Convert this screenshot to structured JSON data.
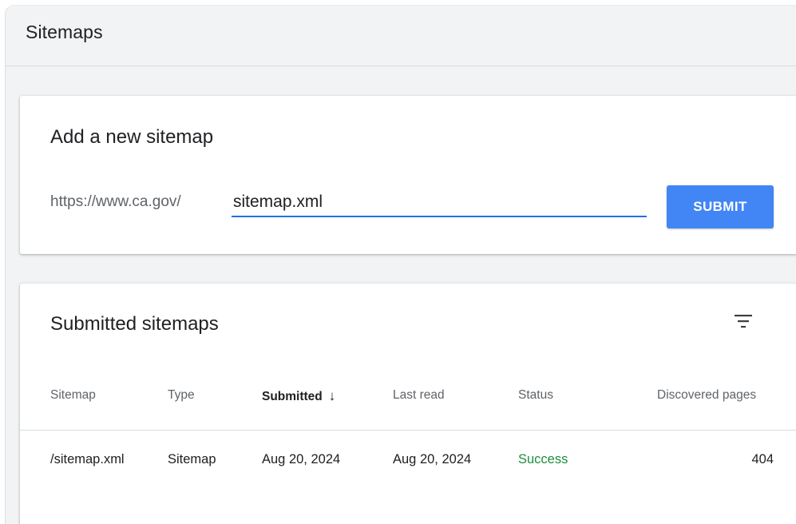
{
  "header": {
    "title": "Sitemaps"
  },
  "add_sitemap": {
    "title": "Add a new sitemap",
    "prefix": "https://www.ca.gov/",
    "input_value": "sitemap.xml",
    "submit_label": "SUBMIT"
  },
  "submitted": {
    "title": "Submitted sitemaps",
    "columns": {
      "sitemap": "Sitemap",
      "type": "Type",
      "submitted": "Submitted",
      "last_read": "Last read",
      "status": "Status",
      "discovered_pages": "Discovered pages"
    },
    "sort_icon": "arrow-down-icon",
    "filter_icon": "filter-icon",
    "rows": [
      {
        "sitemap": "/sitemap.xml",
        "type": "Sitemap",
        "submitted": "Aug 20, 2024",
        "last_read": "Aug 20, 2024",
        "status": "Success",
        "discovered_pages": "404"
      }
    ]
  },
  "colors": {
    "accent": "#4285f4",
    "input_underline": "#1a73e8",
    "success": "#1e8e3e",
    "background": "#f1f3f4"
  }
}
